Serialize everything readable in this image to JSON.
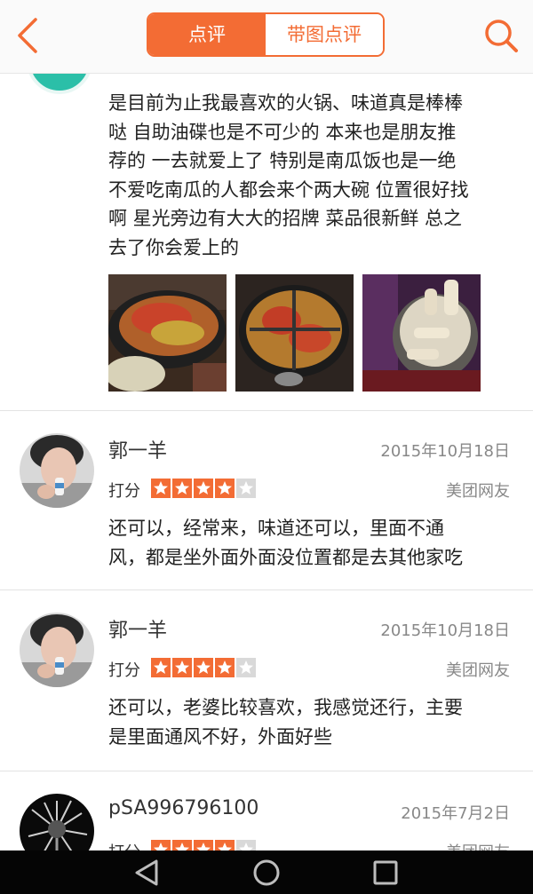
{
  "header": {
    "tabs": [
      {
        "label": "点评",
        "active": true
      },
      {
        "label": "带图点评",
        "active": false
      }
    ]
  },
  "first_review": {
    "text_lines": [
      "是目前为止我最喜欢的火锅、味道真是棒棒",
      "哒 自助油碟也是不可少的 本来也是朋友推",
      "荐的 一去就爱上了 特别是南瓜饭也是一绝",
      "不爱吃南瓜的人都会来个两大碗 位置很好找",
      "啊 星光旁边有大大的招牌 菜品很新鲜 总之",
      "去了你会爱上的"
    ]
  },
  "reviews": [
    {
      "user": "郭一羊",
      "date": "2015年10月18日",
      "rating_label": "打分",
      "rating": 4,
      "source": "美团网友",
      "text_lines": [
        "还可以，经常来，味道还可以，里面不通",
        "风，都是坐外面外面没位置都是去其他家吃"
      ]
    },
    {
      "user": "郭一羊",
      "date": "2015年10月18日",
      "rating_label": "打分",
      "rating": 4,
      "source": "美团网友",
      "text_lines": [
        "还可以，老婆比较喜欢，我感觉还行，主要",
        "是里面通风不好，外面好些"
      ]
    },
    {
      "user": "pSA996796100",
      "date": "2015年7月2日",
      "rating_label": "打分",
      "rating": 4,
      "source": "美团网友",
      "text_lines": []
    }
  ],
  "colors": {
    "accent": "#f36c34",
    "star_on": "#f36c34",
    "star_off": "#d9d9d9"
  },
  "icons": {
    "back": "chevron-left-icon",
    "search": "search-icon",
    "nav_back": "triangle-back-icon",
    "nav_home": "circle-home-icon",
    "nav_recent": "square-recent-icon"
  }
}
